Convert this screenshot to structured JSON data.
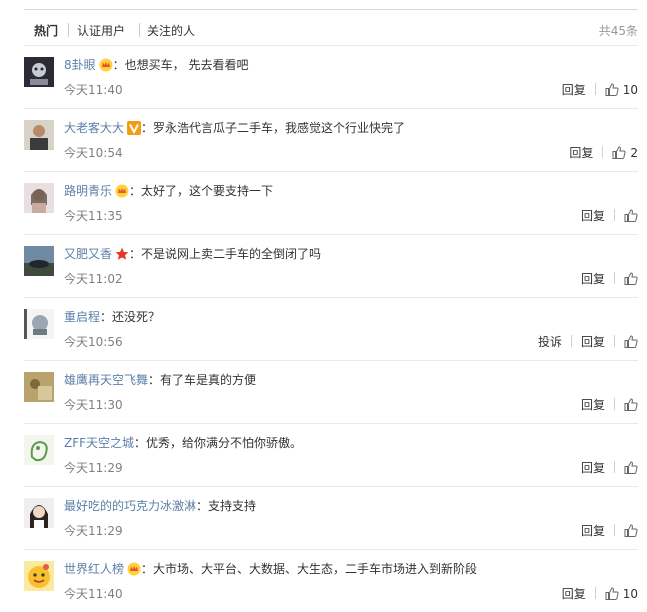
{
  "tabs": {
    "hot": "热门",
    "verified": "认证用户",
    "following": "关注的人",
    "total_count": "共45条"
  },
  "labels": {
    "reply": "回复",
    "report": "投诉",
    "separator": "："
  },
  "colors": {
    "username": "#5c7fa8",
    "text": "#333333",
    "muted": "#808080"
  },
  "comments": [
    {
      "user": "8卦眼",
      "badge": "crown",
      "text": "也想买车， 先去看看吧",
      "time": "今天11:40",
      "likes": "10",
      "has_report": false
    },
    {
      "user": "大老客大大",
      "badge": "v-orange",
      "text": "罗永浩代言瓜子二手车，我感觉这个行业快完了",
      "time": "今天10:54",
      "likes": "2",
      "has_report": false
    },
    {
      "user": "路明青乐",
      "badge": "crown",
      "text": "太好了，这个要支持一下",
      "time": "今天11:35",
      "likes": "",
      "has_report": false
    },
    {
      "user": "又肥又香",
      "badge": "star",
      "text": "不是说网上卖二手车的全倒闭了吗",
      "time": "今天11:02",
      "likes": "",
      "has_report": false
    },
    {
      "user": "重启程",
      "badge": "",
      "text": "还没死？",
      "time": "今天10:56",
      "likes": "",
      "has_report": true
    },
    {
      "user": "雄鹰再天空飞舞",
      "badge": "",
      "text": "有了车是真的方便",
      "time": "今天11:30",
      "likes": "",
      "has_report": false
    },
    {
      "user": "ZFF天空之城",
      "badge": "",
      "text": "优秀，给你满分不怕你骄傲。",
      "time": "今天11:29",
      "likes": "",
      "has_report": false
    },
    {
      "user": "最好吃的的巧克力冰激淋",
      "badge": "",
      "text": "支持支持",
      "time": "今天11:29",
      "likes": "",
      "has_report": false
    },
    {
      "user": "世界红人榜",
      "badge": "crown",
      "text": "大市场、大平台、大数据、大生态，二手车市场进入到新阶段",
      "time": "今天11:40",
      "likes": "10",
      "has_report": false
    }
  ]
}
